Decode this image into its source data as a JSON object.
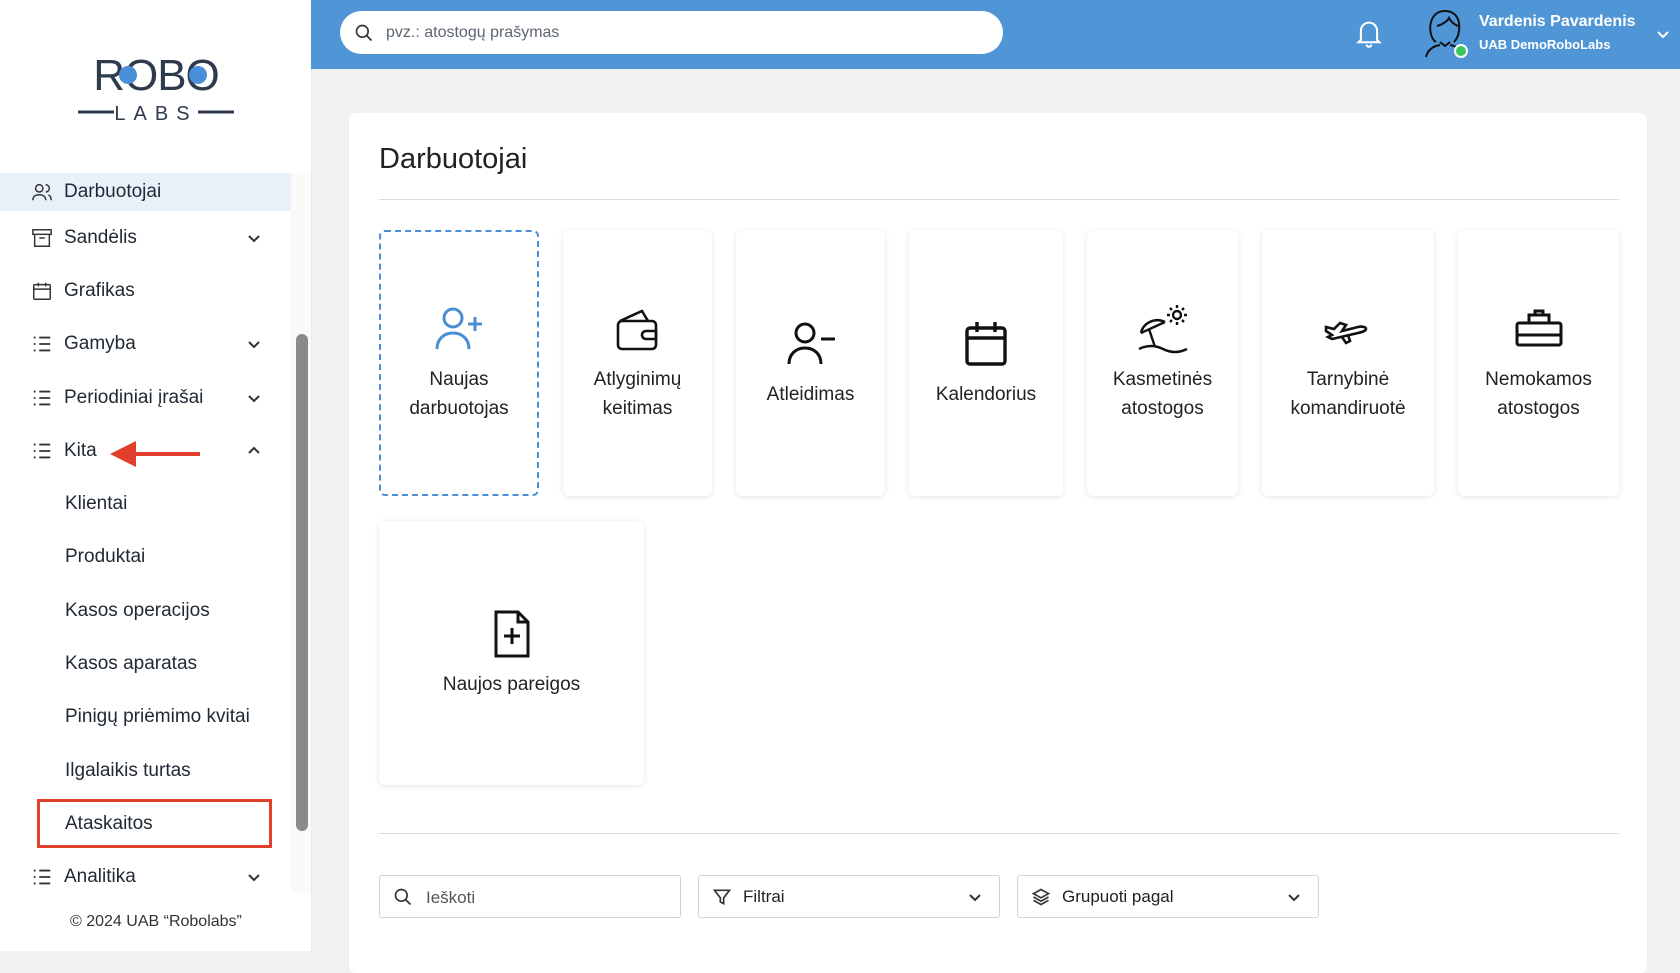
{
  "brand": {
    "logo_top": "ROBO",
    "logo_bottom": "LABS"
  },
  "sidebar": {
    "items": [
      {
        "label": "Darbuotojai",
        "icon": "users-icon",
        "active": true
      },
      {
        "label": "Sandėlis",
        "icon": "archive-icon",
        "chevron": "down"
      },
      {
        "label": "Grafikas",
        "icon": "calendar-icon"
      },
      {
        "label": "Gamyba",
        "icon": "list-icon",
        "chevron": "down"
      },
      {
        "label": "Periodiniai įrašai",
        "icon": "list-icon",
        "chevron": "down"
      },
      {
        "label": "Kita",
        "icon": "list-icon",
        "chevron": "up",
        "expanded": true
      }
    ],
    "kita_subitems": [
      "Klientai",
      "Produktai",
      "Kasos operacijos",
      "Kasos aparatas",
      "Pinigų priėmimo kvitai",
      "Ilgalaikis turtas",
      "Ataskaitos"
    ],
    "after_items": [
      {
        "label": "Analitika",
        "icon": "list-icon",
        "chevron": "down"
      }
    ],
    "highlighted_item": "Ataskaitos",
    "annotation_color": "#e2402c",
    "copyright": "© 2024 UAB “Robolabs”"
  },
  "header": {
    "search_placeholder": "pvz.: atostogų prašymas",
    "user_name": "Vardenis Pavardenis",
    "user_company": "UAB DemoRoboLabs",
    "bar_color": "#5096d6",
    "online_status_color": "#3cc45a"
  },
  "main": {
    "title": "Darbuotojai",
    "tiles": [
      {
        "label_1": "Naujas",
        "label_2": "darbuotojas",
        "icon": "user-plus-icon"
      },
      {
        "label_1": "Atlyginimų",
        "label_2": "keitimas",
        "icon": "wallet-icon"
      },
      {
        "label_1": "Atleidimas",
        "label_2": "",
        "icon": "user-minus-icon"
      },
      {
        "label_1": "Kalendorius",
        "label_2": "",
        "icon": "calendar-icon"
      },
      {
        "label_1": "Kasmetinės",
        "label_2": "atostogos",
        "icon": "beach-umbrella-icon"
      },
      {
        "label_1": "Tarnybinė",
        "label_2": "komandiruotė",
        "icon": "airplane-icon"
      },
      {
        "label_1": "Nemokamos",
        "label_2": "atostogos",
        "icon": "sofa-icon"
      },
      {
        "label_1": "Naujos pareigos",
        "label_2": "",
        "icon": "file-plus-icon"
      }
    ],
    "search_placeholder": "Ieškoti",
    "filter_label": "Filtrai",
    "group_label": "Grupuoti pagal"
  }
}
